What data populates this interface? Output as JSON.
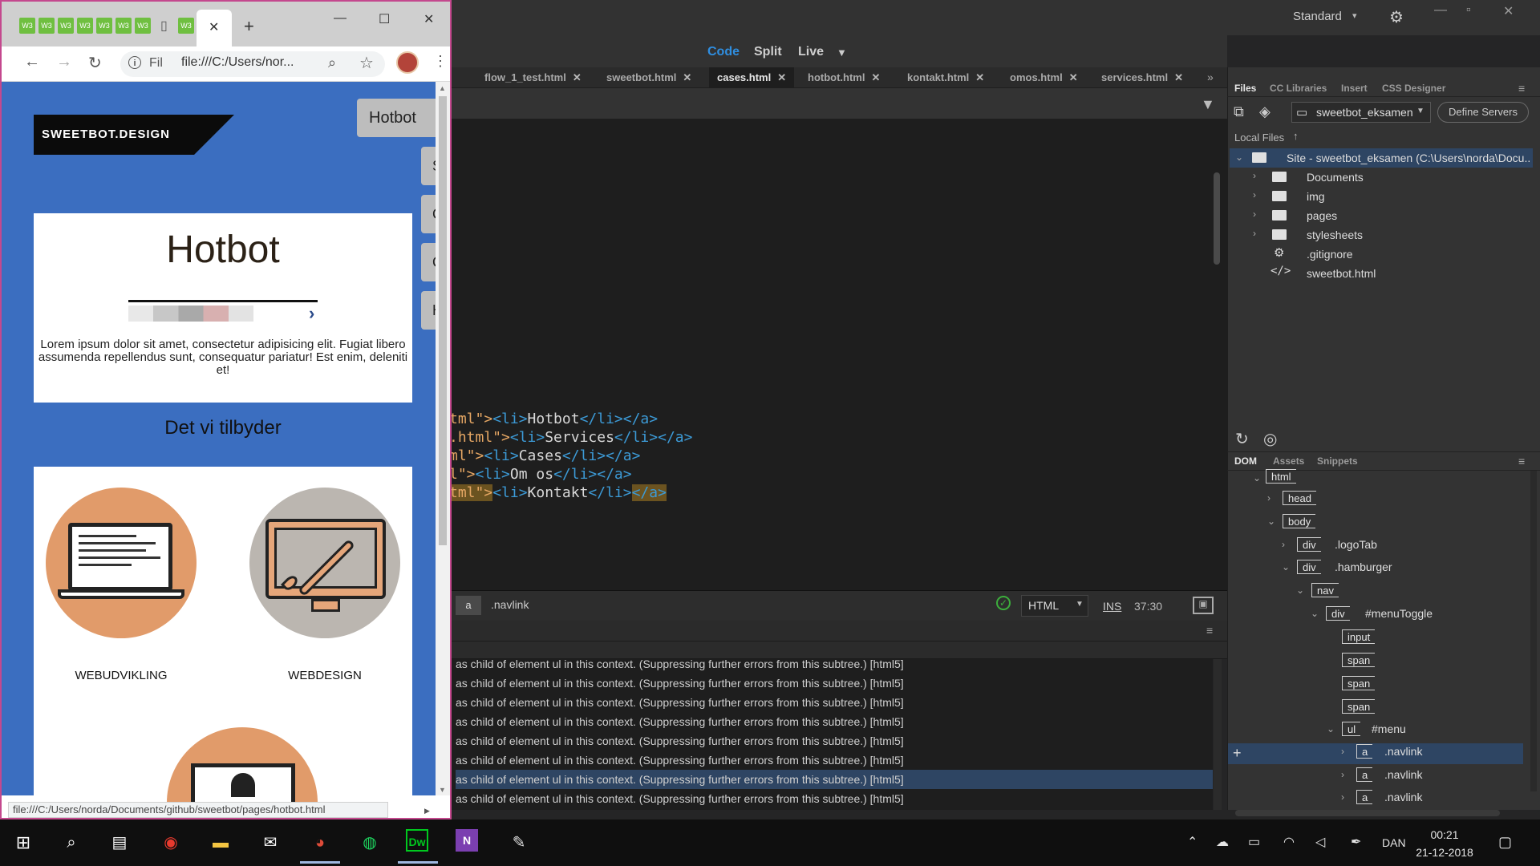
{
  "dreamweaver": {
    "workspace": "Standard",
    "view_buttons": [
      "Code",
      "Split",
      "Live"
    ],
    "doc_tabs": [
      "flow_1_test.html",
      "sweetbot.html",
      "cases.html",
      "hotbot.html",
      "kontakt.html",
      "omos.html",
      "services.html"
    ],
    "active_tab": "cases.html",
    "code_lines": [
      {
        "pre": "tml\">",
        "tag_open": "<li>",
        "text": "Hotbot",
        "tag_close": "</li></a>"
      },
      {
        "pre": ".html\">",
        "tag_open": "<li>",
        "text": "Services",
        "tag_close": "</li></a>"
      },
      {
        "pre": "ml\">",
        "tag_open": "<li>",
        "text": "Cases",
        "tag_close": "</li></a>"
      },
      {
        "pre": "l\">",
        "tag_open": "<li>",
        "text": "Om os",
        "tag_close": "</li></a>"
      },
      {
        "pre": "tml\">",
        "tag_open": "<li>",
        "text": "Kontakt",
        "tag_close": "</li>",
        "tag_end": "</a>"
      }
    ],
    "status": {
      "crumb_tag": "a",
      "crumb_class": ".navlink",
      "doc_type": "HTML",
      "ins": "INS",
      "cursor": "37:30"
    },
    "output_line": "as child of element ul in this context. (Suppressing further errors from this subtree.)  [html5]",
    "files_panel": {
      "tabs": [
        "Files",
        "CC Libraries",
        "Insert",
        "CSS Designer"
      ],
      "site_name": "sweetbot_eksamen",
      "define_servers": "Define Servers",
      "local_files": "Local Files",
      "site_root": "Site - sweetbot_eksamen (C:\\Users\\norda\\Docu...",
      "items": [
        "Documents",
        "img",
        "pages",
        "stylesheets",
        ".gitignore",
        "sweetbot.html"
      ]
    },
    "dom_panel": {
      "tabs": [
        "DOM",
        "Assets",
        "Snippets"
      ],
      "nodes": [
        {
          "tag": "html",
          "label": ""
        },
        {
          "tag": "head",
          "label": ""
        },
        {
          "tag": "body",
          "label": ""
        },
        {
          "tag": "div",
          "label": ".logoTab"
        },
        {
          "tag": "div",
          "label": ".hamburger"
        },
        {
          "tag": "nav",
          "label": ""
        },
        {
          "tag": "div",
          "label": "#menuToggle"
        },
        {
          "tag": "input",
          "label": ""
        },
        {
          "tag": "span",
          "label": ""
        },
        {
          "tag": "span",
          "label": ""
        },
        {
          "tag": "span",
          "label": ""
        },
        {
          "tag": "ul",
          "label": "#menu"
        },
        {
          "tag": "a",
          "label": ".navlink"
        },
        {
          "tag": "a",
          "label": ".navlink"
        },
        {
          "tag": "a",
          "label": ".navlink"
        }
      ]
    }
  },
  "chrome": {
    "url": "file:///C:/Users/nor...",
    "site_chip": "Fil",
    "status_url": "file:///C:/Users/norda/Documents/github/sweetbot/pages/hotbot.html"
  },
  "website": {
    "logo": "SWEETBOT.DESIGN",
    "nav_active": "Hotbot",
    "side_tab_letters": [
      "S",
      "C",
      "C",
      "H"
    ],
    "hero_title": "Hotbot",
    "hero_text": "Lorem ipsum dolor sit amet, consectetur adipisicing elit. Fugiat libero assumenda repellendus sunt, consequatur pariatur! Est enim, deleniti et!",
    "section_title": "Det vi tilbyder",
    "services": [
      "WEBUDVIKLING",
      "WEBDESIGN"
    ]
  },
  "taskbar": {
    "language": "DAN",
    "time": "00:21",
    "date": "21-12-2018"
  }
}
